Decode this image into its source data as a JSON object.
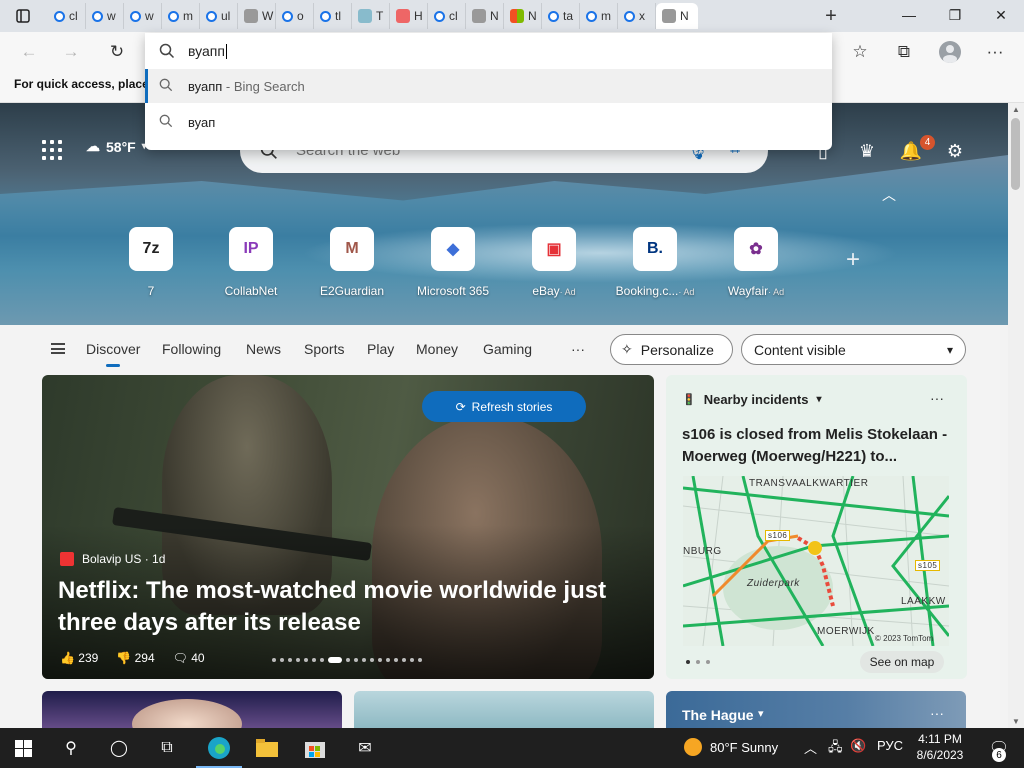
{
  "browser": {
    "tabs": [
      {
        "label": "cl",
        "favicon": "search-icon"
      },
      {
        "label": "w",
        "favicon": "search-icon"
      },
      {
        "label": "w",
        "favicon": "search-icon"
      },
      {
        "label": "m",
        "favicon": "search-icon"
      },
      {
        "label": "ul",
        "favicon": "search-icon"
      },
      {
        "label": "W",
        "favicon": "wiki-icon"
      },
      {
        "label": "o",
        "favicon": "search-icon"
      },
      {
        "label": "tl",
        "favicon": "search-icon"
      },
      {
        "label": "T",
        "favicon": "image-icon"
      },
      {
        "label": "H",
        "favicon": "image-icon"
      },
      {
        "label": "cl",
        "favicon": "search-icon"
      },
      {
        "label": "N",
        "favicon": "page-icon"
      },
      {
        "label": "N",
        "favicon": "microsoft-icon"
      },
      {
        "label": "ta",
        "favicon": "search-icon"
      },
      {
        "label": "m",
        "favicon": "search-icon"
      },
      {
        "label": "x",
        "favicon": "search-icon"
      },
      {
        "label": "N",
        "favicon": "newtab-icon",
        "active": true
      }
    ],
    "new_tab_symbol": "+",
    "window_controls": {
      "minimize": "—",
      "restore": "❐",
      "close": "✕"
    }
  },
  "address": {
    "typed": "вуапп",
    "suggestions": [
      {
        "text": "вуапп",
        "suffix": " - Bing Search",
        "highlighted": true
      },
      {
        "text": "вуап",
        "suffix": "",
        "highlighted": false
      }
    ]
  },
  "favorites_bar": {
    "text": "For quick access, place y"
  },
  "newtab": {
    "weather": {
      "temp": "58°F"
    },
    "search_placeholder": "Search the web",
    "notification_count": "4",
    "quick_links": [
      {
        "label": "7",
        "icon_text": "7z",
        "icon_color": "#222222",
        "ad": ""
      },
      {
        "label": "CollabNet",
        "icon_text": "IP",
        "icon_color": "#8a3ab9",
        "ad": ""
      },
      {
        "label": "E2Guardian",
        "icon_text": "M",
        "icon_color": "#a0574a",
        "ad": ""
      },
      {
        "label": "Microsoft 365",
        "icon_text": "◆",
        "icon_color": "#3d6fd8",
        "ad": ""
      },
      {
        "label": "eBay",
        "icon_text": "▣",
        "icon_color": "#e53238",
        "ad": "· Ad"
      },
      {
        "label": "Booking.c...",
        "icon_text": "B.",
        "icon_color": "#003580",
        "ad": "· Ad"
      },
      {
        "label": "Wayfair",
        "icon_text": "✿",
        "icon_color": "#7a2e8e",
        "ad": "· Ad"
      }
    ],
    "add_link_symbol": "+",
    "nav_tabs": [
      "Discover",
      "Following",
      "News",
      "Sports",
      "Play",
      "Money",
      "Gaming"
    ],
    "more_symbol": "···",
    "personalize_label": "Personalize",
    "content_visible_label": "Content visible",
    "refresh_label": "Refresh stories",
    "feature": {
      "source": "Bolavip US · 1d",
      "headline": "Netflix: The most-watched movie worldwide just three days after its release",
      "likes": "239",
      "dislikes": "294",
      "comments": "40"
    },
    "traffic": {
      "header": "Nearby incidents",
      "title": "s106 is closed from Melis Stokelaan - Moerweg (Moerweg/H221) to...",
      "map_labels": [
        "TRANSVAALKWARTIER",
        "NBURG",
        "Zuiderpark",
        "LAAKKW",
        "MOERWIJK",
        "s106",
        "s105",
        "© 2023 TomTom"
      ],
      "see_on_map": "See on map"
    },
    "bottom_card_title": "The Hague"
  },
  "taskbar": {
    "weather": "80°F Sunny",
    "language": "РУС",
    "time": "4:11 PM",
    "date": "8/6/2023",
    "notification_count": "6"
  }
}
